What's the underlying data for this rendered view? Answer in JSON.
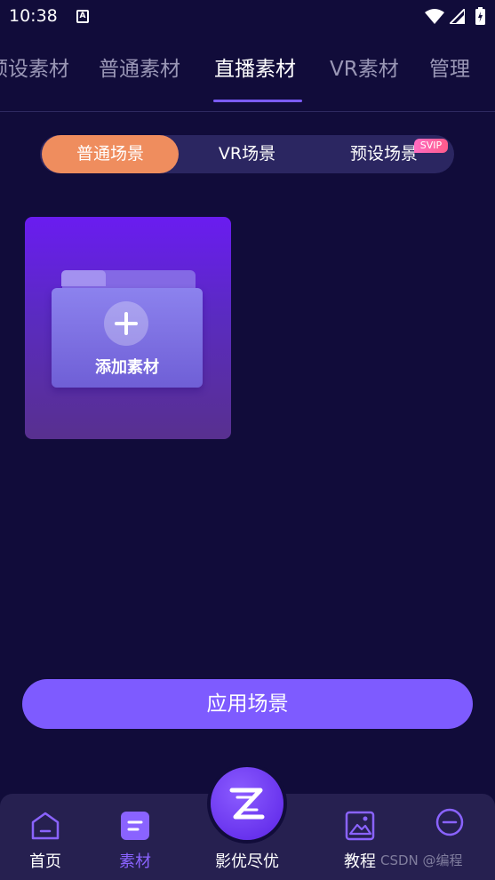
{
  "status_bar": {
    "time": "10:38",
    "notif_glyph": "A"
  },
  "top_tabs": [
    {
      "label": "预设素材"
    },
    {
      "label": "普通素材"
    },
    {
      "label": "直播素材"
    },
    {
      "label": "VR素材"
    },
    {
      "label": "管理"
    }
  ],
  "scene_tabs": [
    {
      "label": "普通场景"
    },
    {
      "label": "VR场景"
    },
    {
      "label": "预设场景"
    }
  ],
  "svip_badge": "SVIP",
  "add_card": {
    "label": "添加素材"
  },
  "apply_button": "应用场景",
  "bottom_nav": [
    {
      "label": "首页",
      "icon": "home-icon"
    },
    {
      "label": "素材",
      "icon": "material-icon"
    },
    {
      "label": "影优尽优",
      "icon": "z-logo-icon"
    },
    {
      "label": "教程",
      "icon": "image-icon"
    },
    {
      "label": "",
      "icon": "minus-circle-icon"
    }
  ],
  "watermark": "CSDN @编程"
}
